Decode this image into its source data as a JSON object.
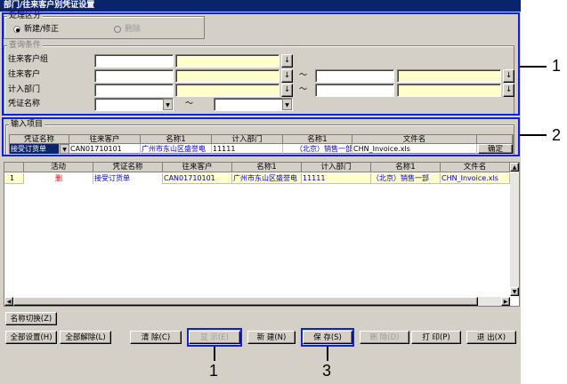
{
  "window": {
    "title": "部门/往来客户别凭证设置"
  },
  "process_group": {
    "legend": "处理区分",
    "option_new": "新建/修正",
    "option_delete": "删除"
  },
  "query_group": {
    "legend": "查询条件",
    "row1_label": "往来客户组",
    "row2_label": "往来客户",
    "row3_label": "计入部门",
    "row4_label": "凭证名称",
    "lookup_button": "↓",
    "range_sep": "～"
  },
  "input_group": {
    "legend": "输入项目",
    "headers": [
      "凭证名称",
      "往来客户",
      "名称1",
      "计入部门",
      "名称1",
      "文件名"
    ],
    "row": {
      "voucher": "接受订货单",
      "customer": "CAN01710101",
      "customer_name": "广州市东山区盛誉电",
      "dept": "11111",
      "dept_name": "（北京）销售一部",
      "file": "CHN_Invoice.xls"
    },
    "confirm_button": "确定"
  },
  "main_table": {
    "headers": [
      "活动",
      "凭证名称",
      "往来客户",
      "名称1",
      "计入部门",
      "名称1",
      "文件名"
    ],
    "rows": [
      {
        "no": "1",
        "activity": "删",
        "voucher": "接受订货单",
        "customer": "CAN01710101",
        "customer_name": "广州市东山区盛誉电",
        "dept": "11111",
        "dept_name": "（北京）销售一部",
        "file": "CHN_Invoice.xls"
      }
    ]
  },
  "buttons": {
    "name_switch": "名称切换(Z)",
    "select_all": "全部设置(H)",
    "deselect_all": "全部解除(L)",
    "clear": "清 除(C)",
    "show": "显 示(E)",
    "new": "新 建(N)",
    "save": "保 存(S)",
    "delete": "删 除(D)",
    "print": "打 印(P)",
    "exit": "退 出(X)"
  },
  "callouts": [
    "1",
    "2",
    "1",
    "3"
  ],
  "colors": {
    "callout": "#1020e0",
    "titlebar": "#0a246a",
    "highlight": "#ffffcc",
    "blue_text": "#0000c0"
  }
}
